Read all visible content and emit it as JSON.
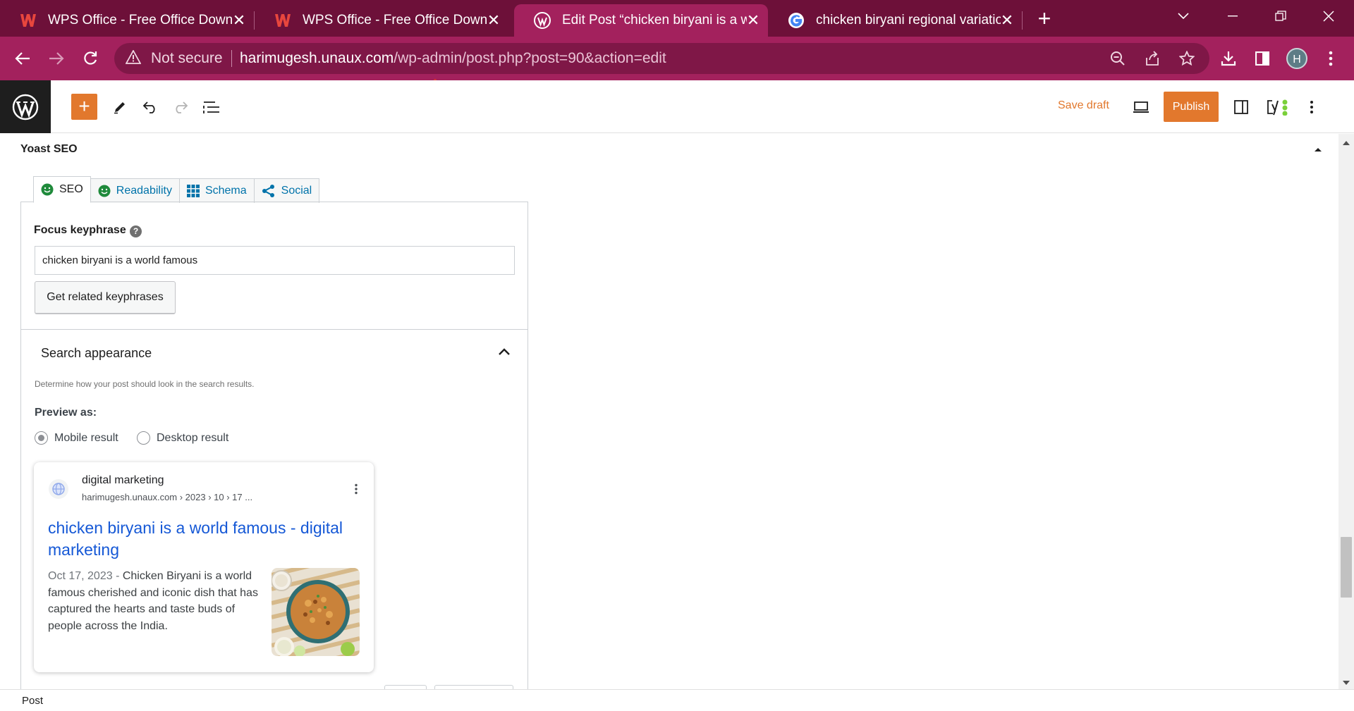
{
  "browser": {
    "tabs": [
      {
        "title": "WPS Office - Free Office Downlo",
        "icon": "wps-icon"
      },
      {
        "title": "WPS Office - Free Office Downlo",
        "icon": "wps-icon"
      },
      {
        "title": "Edit Post “chicken biryani is a wo",
        "icon": "wordpress-icon"
      },
      {
        "title": "chicken biryani regional variation",
        "icon": "google-icon"
      }
    ],
    "active_tab": 2,
    "close_glyph": "✕",
    "new_tab_glyph": "+",
    "security_label": "Not secure",
    "url_host": "harimugesh.unaux.com",
    "url_path": "/wp-admin/post.php?post=90&action=edit",
    "profile_initial": "H",
    "colors": {
      "frame": "#6d1039",
      "toolbar": "#a3215d",
      "omnibox": "#7f1747"
    }
  },
  "editor": {
    "save_draft": "Save draft",
    "publish": "Publish",
    "accent": "#e2782d",
    "inserter_glyph": "+"
  },
  "yoast": {
    "title": "Yoast SEO",
    "tabs": [
      {
        "label": "SEO",
        "icon": "smiley-icon"
      },
      {
        "label": "Readability",
        "icon": "smiley-icon"
      },
      {
        "label": "Schema",
        "icon": "grid-icon"
      },
      {
        "label": "Social",
        "icon": "share-icon"
      }
    ],
    "focus_keyphrase_label": "Focus keyphrase",
    "help_glyph": "?",
    "focus_keyphrase_value": "chicken biryani is a world famous",
    "related_button": "Get related keyphrases",
    "search_appearance": {
      "title": "Search appearance",
      "description": "Determine how your post should look in the search results.",
      "preview_as_label": "Preview as:",
      "options": [
        "Mobile result",
        "Desktop result"
      ],
      "selected": "Mobile result"
    },
    "serp": {
      "site_name": "digital marketing",
      "breadcrumb": "harimugesh.unaux.com › 2023 › 10 › 17 ...",
      "title": "chicken biryani is a world famous - digital marketing",
      "date": "Oct 17, 2023",
      "date_sep": " - ",
      "snippet": "Chicken Biryani is a world famous cherished and iconic dish that has captured the hearts and taste buds of people across the India."
    }
  },
  "footer": {
    "breadcrumb": "Post"
  }
}
